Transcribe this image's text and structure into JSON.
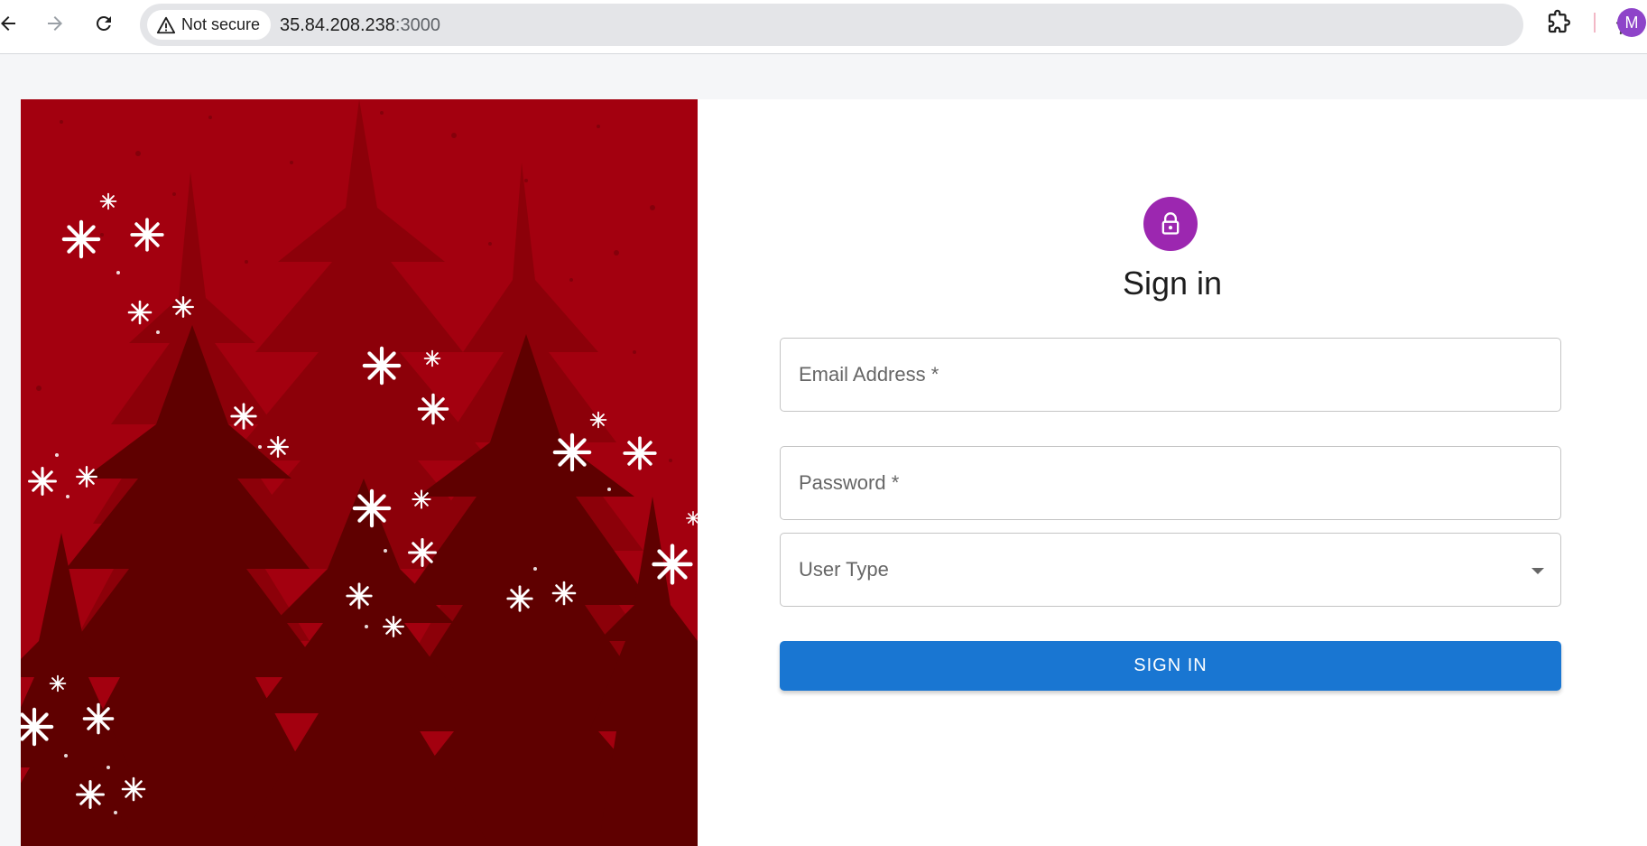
{
  "browser": {
    "security_chip": "Not secure",
    "url_host": "35.84.208.238",
    "url_port": ":3000",
    "profile_initial": "M"
  },
  "login": {
    "title": "Sign in",
    "email_label": "Email Address *",
    "password_label": "Password *",
    "user_type_label": "User Type",
    "submit_label": "SIGN IN"
  },
  "colors": {
    "accent_button": "#1976d2",
    "avatar_circle": "#9c27b0",
    "hero_background": "#a3000f"
  },
  "icons": [
    "back-arrow-icon",
    "forward-arrow-icon",
    "reload-icon",
    "warning-icon",
    "star-icon",
    "puzzle-icon",
    "lock-icon",
    "dropdown-caret-icon",
    "snowflake-icon",
    "pine-tree"
  ]
}
